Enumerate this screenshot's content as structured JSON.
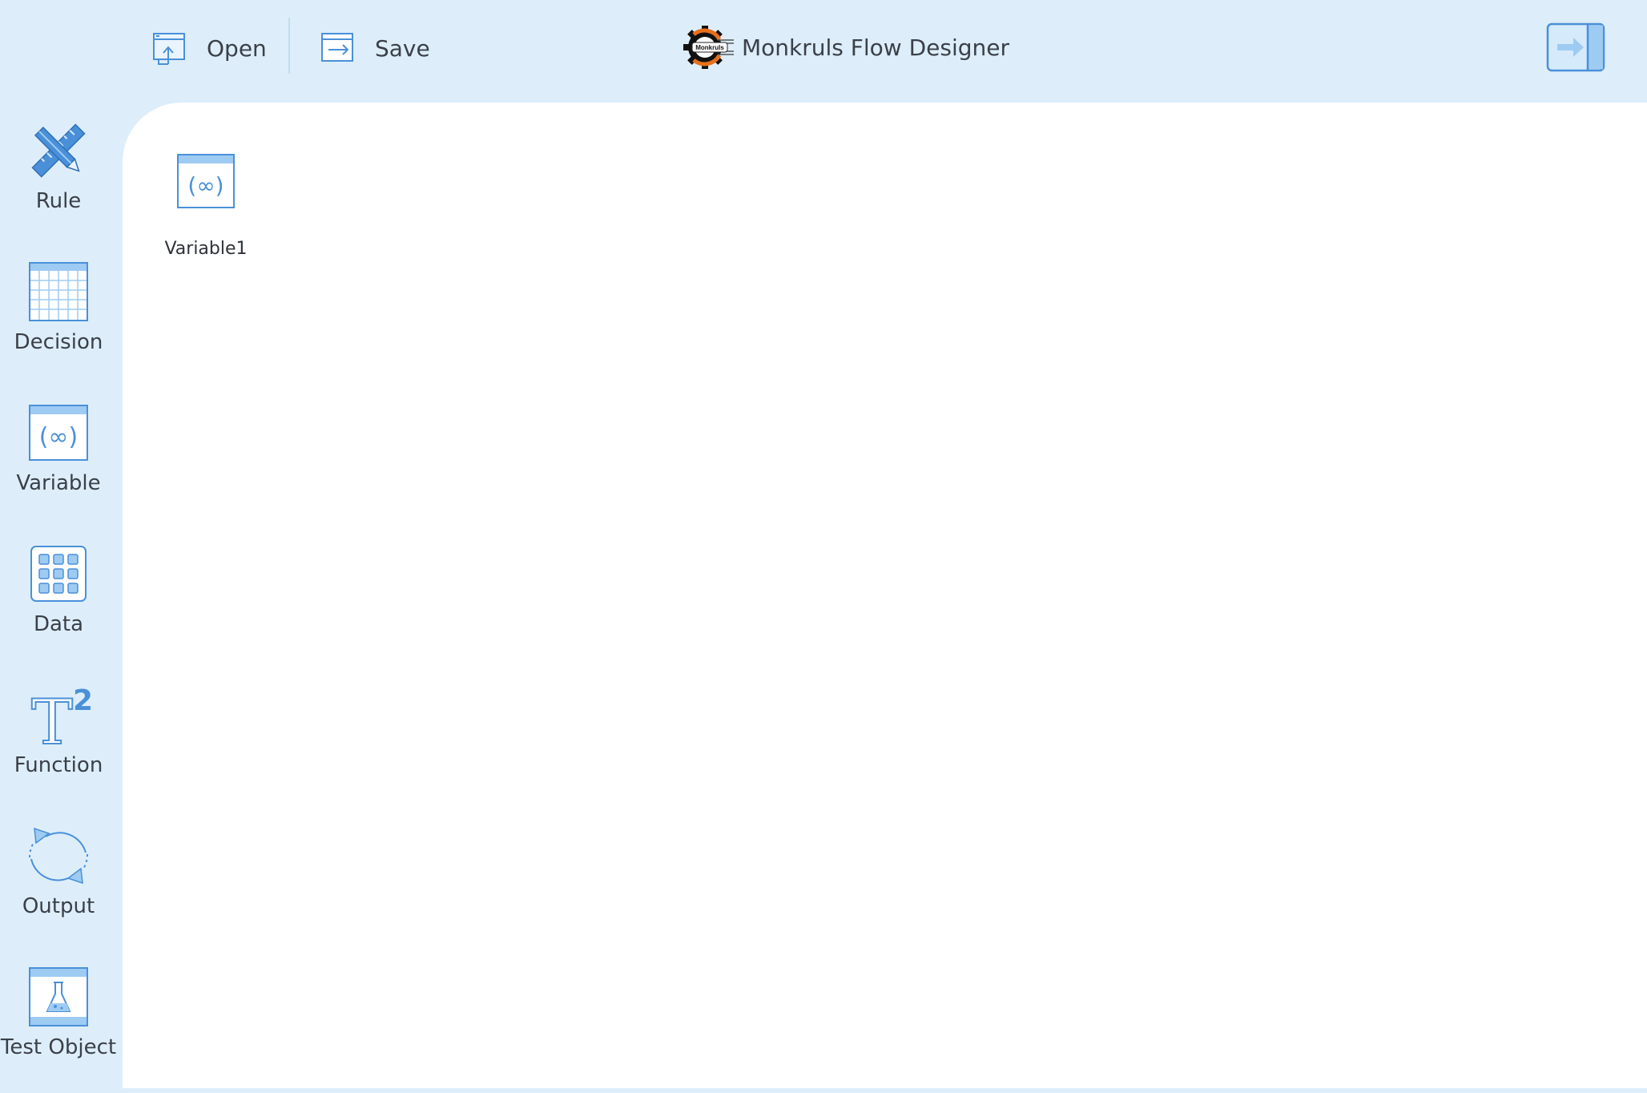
{
  "toolbar": {
    "open_label": "Open",
    "save_label": "Save",
    "app_title": "Monkruls Flow Designer",
    "logo_text": "Monkruls"
  },
  "sidebar": {
    "items": [
      {
        "label": "Rule",
        "icon": "ruler-pencil-icon"
      },
      {
        "label": "Decision",
        "icon": "grid-table-icon"
      },
      {
        "label": "Variable",
        "icon": "variable-icon"
      },
      {
        "label": "Data",
        "icon": "data-dots-icon"
      },
      {
        "label": "Function",
        "icon": "function-t2-icon"
      },
      {
        "label": "Output",
        "icon": "cycle-arrows-icon"
      },
      {
        "label": "Test Object",
        "icon": "flask-icon"
      }
    ]
  },
  "canvas": {
    "nodes": [
      {
        "label": "Variable1",
        "icon": "variable-icon"
      }
    ]
  },
  "colors": {
    "background": "#ddeefa",
    "accent": "#4a90d9",
    "accent_light": "#9ecbf2",
    "canvas": "#ffffff"
  }
}
